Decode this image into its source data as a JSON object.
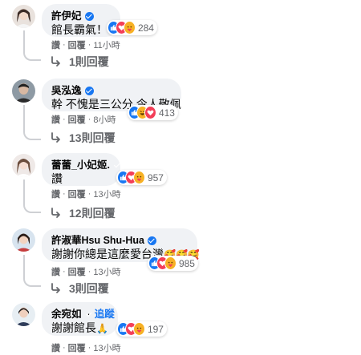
{
  "comments": [
    {
      "name": "許伊妃",
      "verified": true,
      "follow": "",
      "text": "館長霸氣！",
      "reactions": [
        "like",
        "love",
        "care"
      ],
      "reaction_count": "284",
      "actions": [
        "讚",
        "回覆",
        "11小時"
      ],
      "replies": "1則回覆"
    },
    {
      "name": "吳泓逸",
      "verified": true,
      "follow": "",
      "text": "幹 不愧是三公分 令人敬佩",
      "reactions": [
        "like",
        "haha",
        "love"
      ],
      "reaction_count": "413",
      "actions": [
        "讚",
        "回覆",
        "8小時"
      ],
      "replies": "13則回覆"
    },
    {
      "name": "蕾蕾_小妃姬.",
      "verified": true,
      "follow": "",
      "text": "讚",
      "reactions": [
        "like",
        "love",
        "care"
      ],
      "reaction_count": "957",
      "actions": [
        "讚",
        "回覆",
        "13小時"
      ],
      "replies": "12則回覆"
    },
    {
      "name": "許淑華Hsu Shu-Hua",
      "verified": true,
      "follow": "",
      "text": "謝謝你總是這麼愛台灣",
      "emoji_suffix": "🥰🥰🥰",
      "reactions": [
        "like",
        "love",
        "care"
      ],
      "reaction_count": "985",
      "actions": [
        "讚",
        "回覆",
        "13小時"
      ],
      "replies": "3則回覆"
    },
    {
      "name": "余宛如",
      "verified": true,
      "follow": "追蹤",
      "text": "謝謝館長",
      "emoji_suffix": "🙏",
      "reactions": [
        "like",
        "love",
        "care"
      ],
      "reaction_count": "197",
      "actions": [
        "讚",
        "回覆",
        "13小時"
      ],
      "replies": ""
    }
  ],
  "colors": {
    "bubble": "#f0f2f5",
    "link": "#1877f2",
    "secondary": "#65676b",
    "thread": "#ced0d4"
  }
}
